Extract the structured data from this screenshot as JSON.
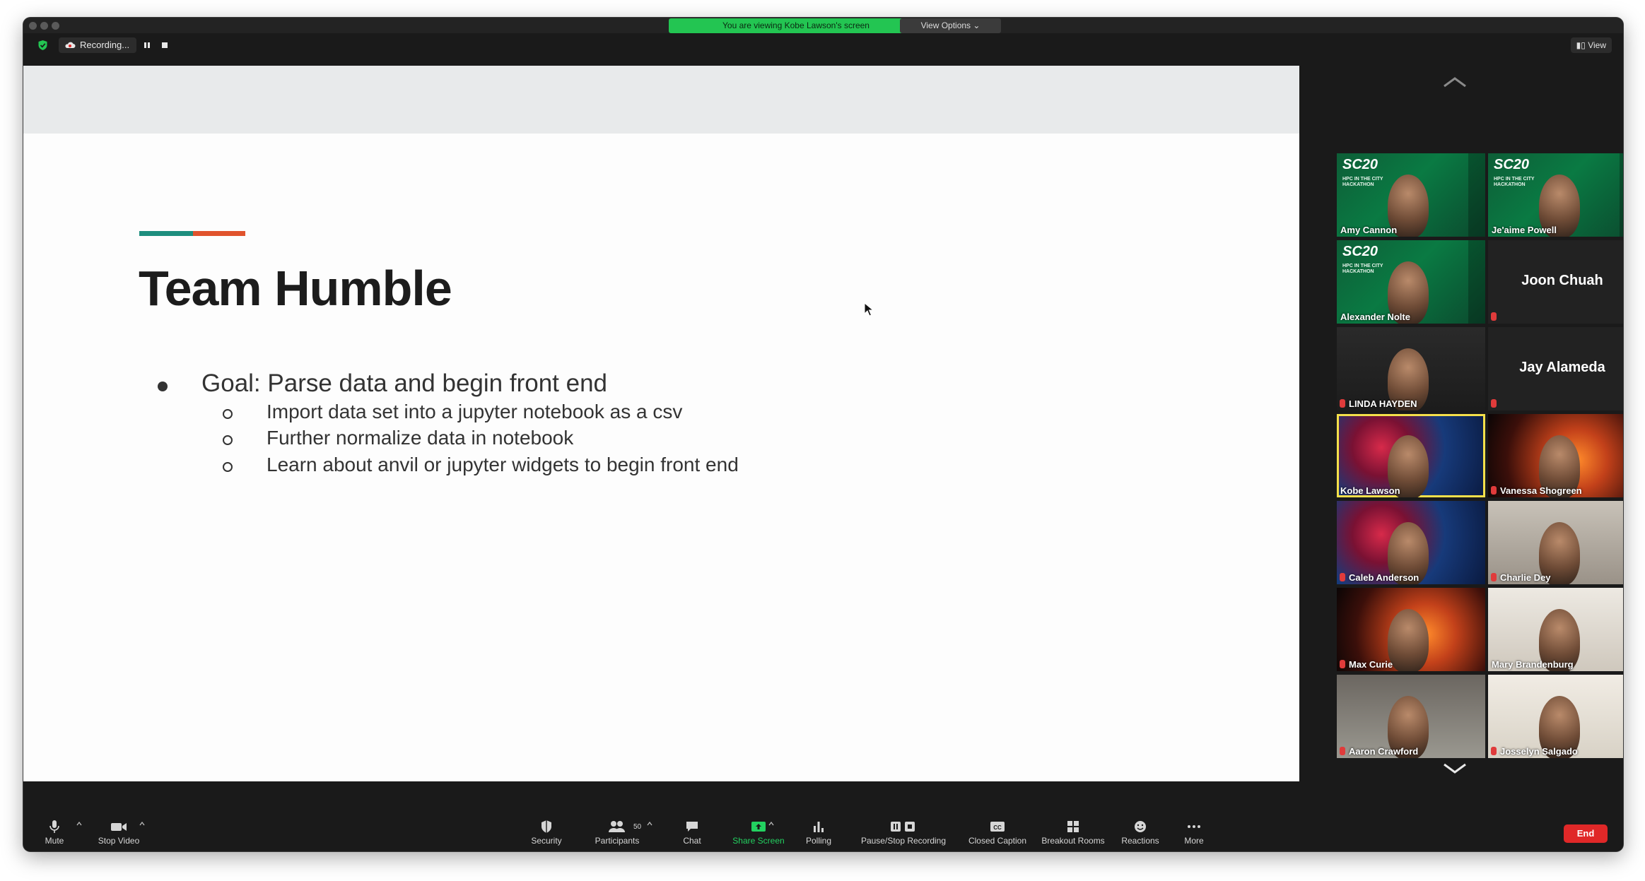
{
  "banner": {
    "share_text": "You are viewing Kobe Lawson's screen",
    "view_options": "View Options ⌄"
  },
  "topbar": {
    "recording_label": "Recording...",
    "view_label": "View"
  },
  "slide": {
    "title": "Team Humble",
    "bullet": "Goal: Parse data and begin front end",
    "sub_bullets": [
      "Import data set into a jupyter notebook as a csv",
      "Further normalize data in notebook",
      "Learn about anvil or jupyter widgets to begin front end"
    ],
    "accent_colors": [
      "#1e8e7e",
      "#e0532d"
    ]
  },
  "participants": [
    {
      "name": "Amy Cannon",
      "muted": false,
      "bg": "sc20"
    },
    {
      "name": "Je'aime Powell",
      "muted": false,
      "bg": "sc20"
    },
    {
      "name": "Alexander Nolte",
      "muted": false,
      "bg": "sc20"
    },
    {
      "name": "Joon Chuah",
      "muted": true,
      "bg": "none"
    },
    {
      "name": "LINDA HAYDEN",
      "muted": true,
      "bg": "dark"
    },
    {
      "name": "Jay Alameda",
      "muted": true,
      "bg": "none"
    },
    {
      "name": "Kobe Lawson",
      "muted": false,
      "bg": "virus",
      "active_speaker": true
    },
    {
      "name": "Vanessa Shogreen",
      "muted": true,
      "bg": "space"
    },
    {
      "name": "Caleb Anderson",
      "muted": true,
      "bg": "virus"
    },
    {
      "name": "Charlie Dey",
      "muted": true,
      "bg": "room"
    },
    {
      "name": "Max Curie",
      "muted": true,
      "bg": "space"
    },
    {
      "name": "Mary Brandenburg",
      "muted": false,
      "bg": "light"
    },
    {
      "name": "Aaron Crawford",
      "muted": true,
      "bg": "room2"
    },
    {
      "name": "Josselyn Salgado",
      "muted": true,
      "bg": "bright"
    }
  ],
  "sc20_tile": {
    "logo": "SC20",
    "subtitle": "HPC IN THE CITY HACKATHON"
  },
  "toolbar": {
    "mute": "Mute",
    "stop_video": "Stop Video",
    "security": "Security",
    "participants": "Participants",
    "participants_count": "50",
    "chat": "Chat",
    "share_screen": "Share Screen",
    "polling": "Polling",
    "pause_stop_recording": "Pause/Stop Recording",
    "closed_caption": "Closed Caption",
    "breakout_rooms": "Breakout Rooms",
    "reactions": "Reactions",
    "more": "More",
    "end": "End"
  },
  "colors": {
    "share_banner": "#23c552",
    "end_button": "#e02828",
    "active_speaker_border": "#f5e04a"
  }
}
